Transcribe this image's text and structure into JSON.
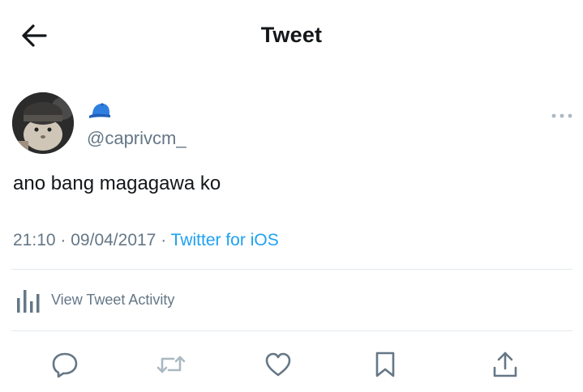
{
  "header": {
    "title": "Tweet",
    "back_icon": "arrow-left-icon"
  },
  "user": {
    "handle": "@caprivcm_",
    "display_name_icon": "blue-cap-emoji",
    "avatar": "cat-with-beanie-avatar"
  },
  "tweet": {
    "text": "ano bang magagawa ko",
    "time": "21:10",
    "separator": "·",
    "date": "09/04/2017",
    "source": "Twitter for iOS"
  },
  "activity": {
    "label": "View Tweet Activity",
    "icon": "bar-chart-icon"
  },
  "actions": [
    "reply-icon",
    "retweet-icon",
    "like-icon",
    "bookmark-icon",
    "share-icon"
  ],
  "colors": {
    "accent": "#1da1f2",
    "secondary_text": "#657786",
    "primary_text": "#14171a",
    "divider": "#e1e8ed"
  }
}
